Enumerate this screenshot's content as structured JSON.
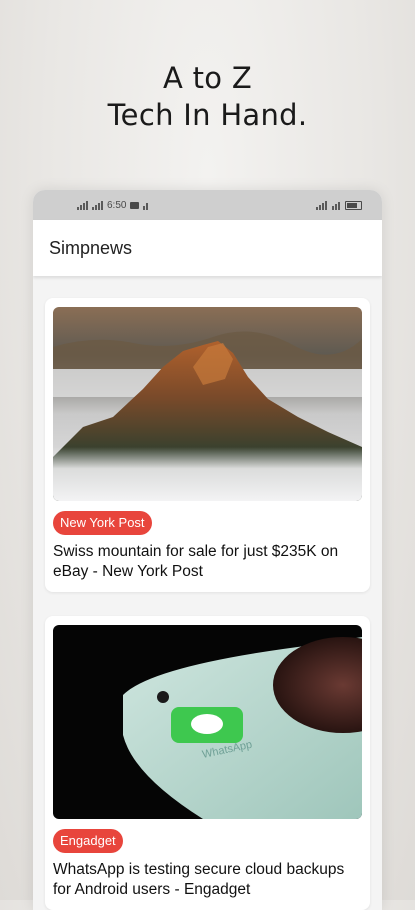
{
  "headline": {
    "line1": "A to Z",
    "line2": "Tech In Hand."
  },
  "status_bar": {
    "time": "6:50",
    "left_icons": [
      "signal-icon",
      "signal-icon",
      "time",
      "message-icon",
      "signal-icon"
    ],
    "right_icons": [
      "signal-icon",
      "wifi-icon",
      "battery-icon"
    ]
  },
  "app_bar": {
    "title": "Simpnews"
  },
  "articles": [
    {
      "source": "New York Post",
      "title": "Swiss mountain for sale for just $235K on eBay - New York Post",
      "image": "mountain-photo"
    },
    {
      "source": "Engadget",
      "title": "WhatsApp is testing secure cloud backups for Android users - Engadget",
      "image": "whatsapp-phone-photo",
      "image_label": "WhatsApp"
    }
  ],
  "colors": {
    "badge": "#e8453c",
    "status_bar": "#cfcfcf",
    "whatsapp_green": "#3ec84f"
  }
}
